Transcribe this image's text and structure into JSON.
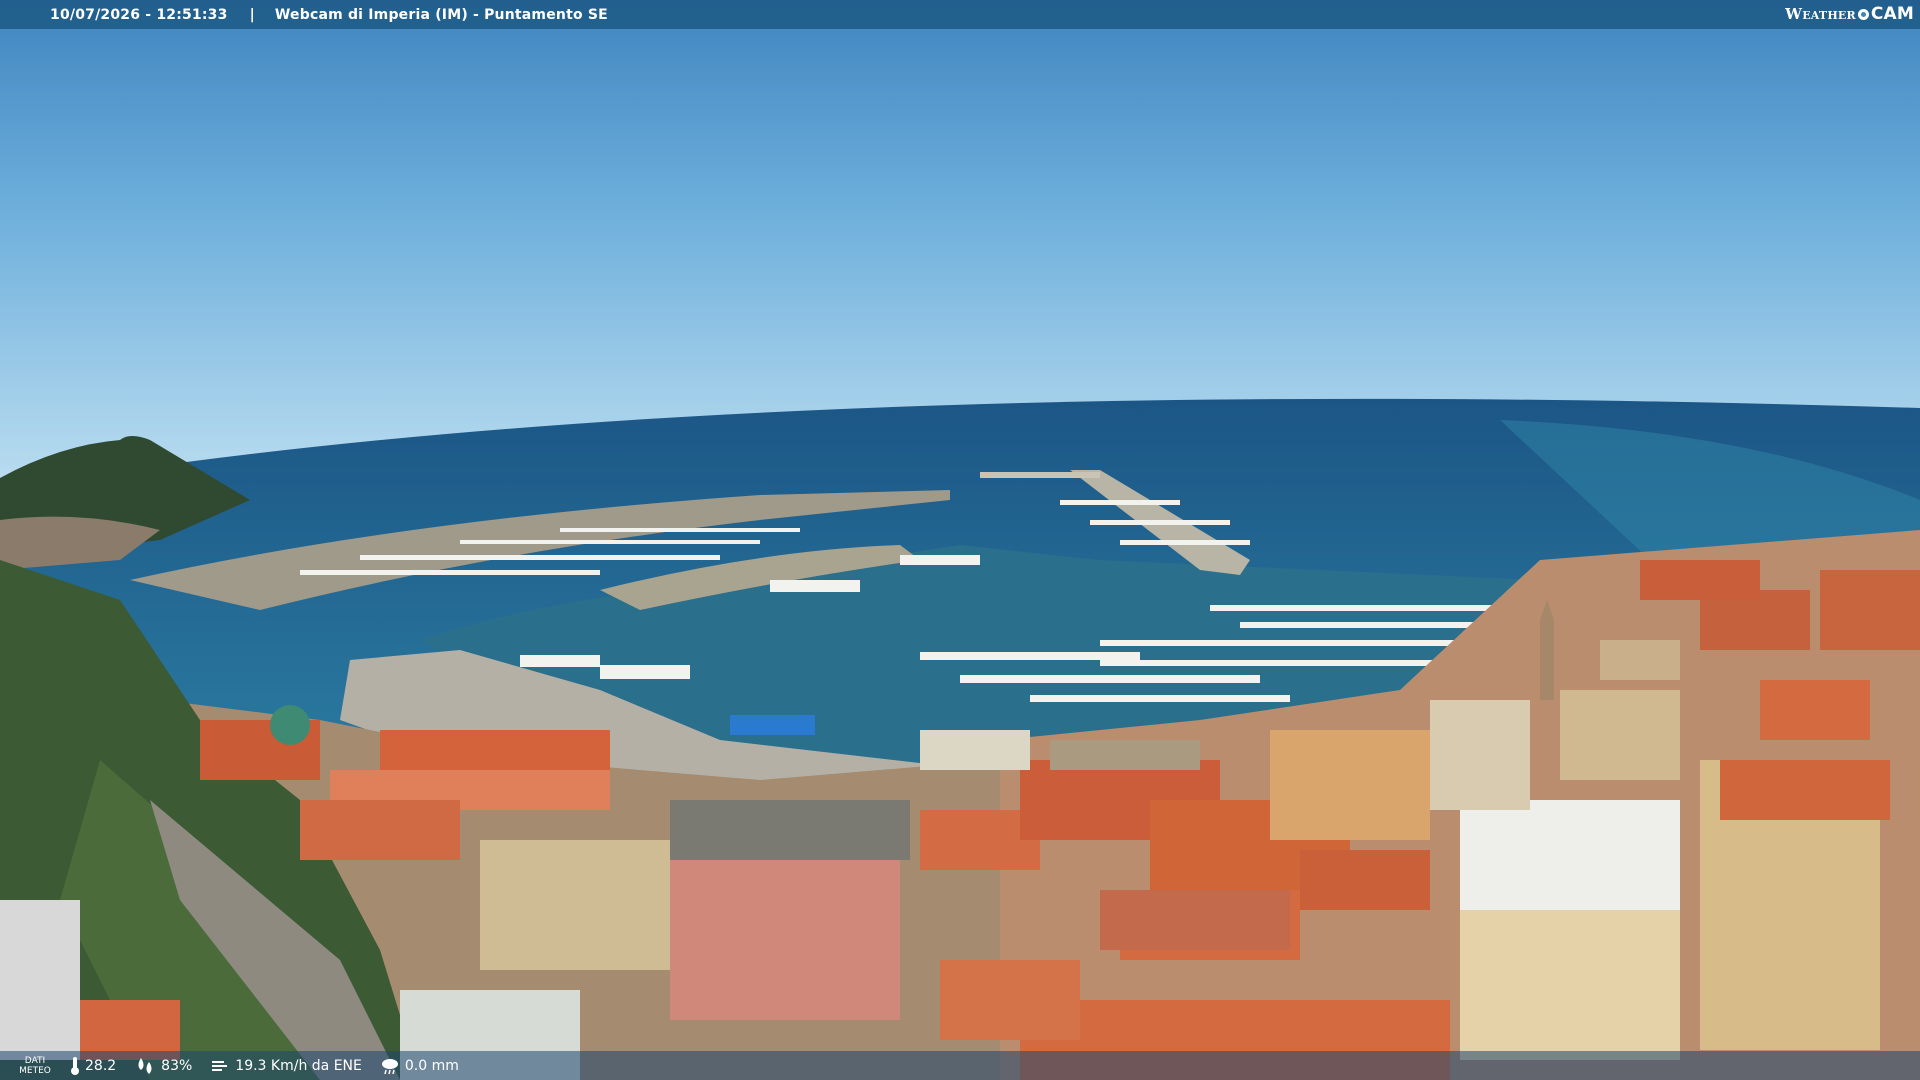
{
  "overlay": {
    "datetime": "10/07/2026 - 12:51:33",
    "separator": "|",
    "camera_title": "Webcam di Imperia (IM) - Puntamento SE",
    "logo_left": "Weather",
    "logo_right": "CAM"
  },
  "meteo": {
    "label_line1": "DATI",
    "label_line2": "METEO",
    "temperature": "28.2",
    "humidity": "83%",
    "wind": "19.3 Km/h da ENE",
    "rain": "0.0 mm"
  },
  "icons": {
    "temperature": "thermometer-icon",
    "humidity": "humidity-drops-icon",
    "wind": "wind-icon",
    "rain": "rain-cloud-icon",
    "logo": "weathercam-logo"
  },
  "colors": {
    "sky_top": "#3f85c0",
    "sky_horizon": "#b9dcf0",
    "sea": "#1e5f8a",
    "harbor_water": "#2a6f8c",
    "roofs": "#d4623a",
    "hill": "#2f4a30"
  }
}
